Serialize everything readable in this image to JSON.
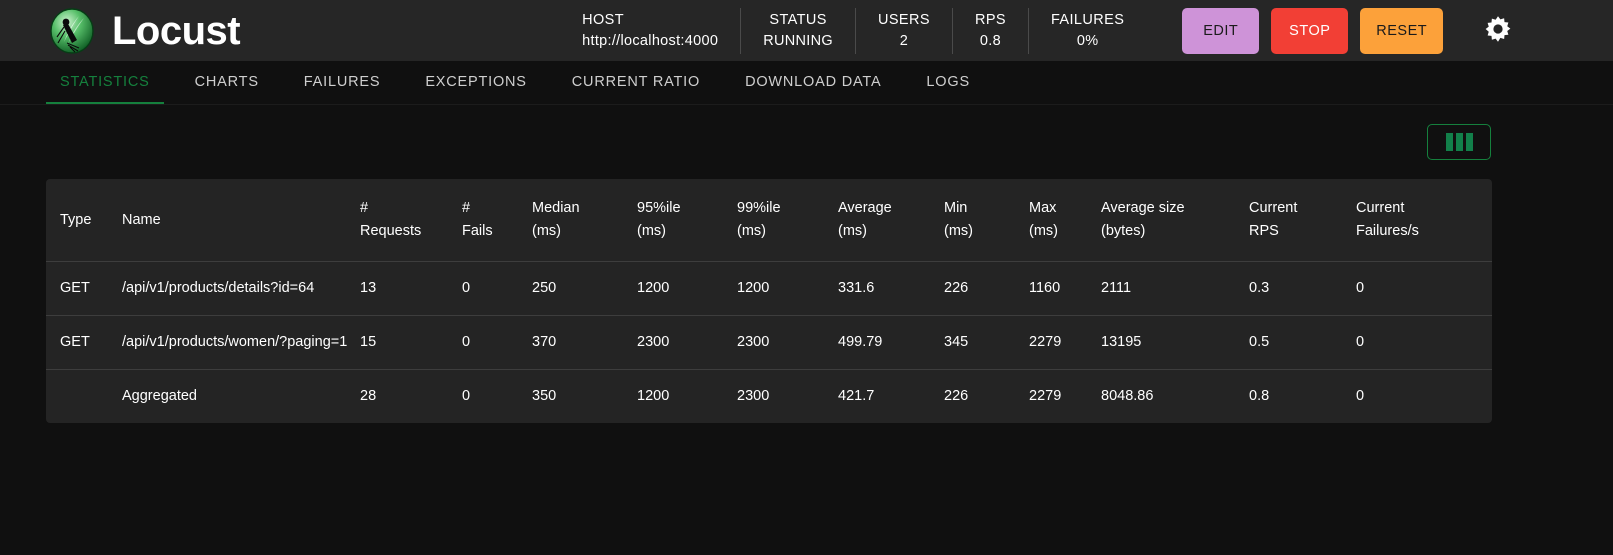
{
  "app": {
    "brand_name": "Locust",
    "logo_icon": "locust-logo-icon"
  },
  "header": {
    "stats": [
      {
        "label": "HOST",
        "value": "http://localhost:4000"
      },
      {
        "label": "STATUS",
        "value": "RUNNING"
      },
      {
        "label": "USERS",
        "value": "2"
      },
      {
        "label": "RPS",
        "value": "0.8"
      },
      {
        "label": "FAILURES",
        "value": "0%"
      }
    ],
    "buttons": {
      "edit": "EDIT",
      "stop": "STOP",
      "reset": "RESET"
    },
    "settings_icon": "gear-icon",
    "colors": {
      "edit_bg": "#ce93d8",
      "stop_bg": "#f23f35",
      "reset_bg": "#fca13a",
      "topbar_bg": "#262626"
    }
  },
  "tabs": {
    "active": "STATISTICS",
    "items": [
      {
        "label": "STATISTICS"
      },
      {
        "label": "CHARTS"
      },
      {
        "label": "FAILURES"
      },
      {
        "label": "EXCEPTIONS"
      },
      {
        "label": "CURRENT RATIO"
      },
      {
        "label": "DOWNLOAD DATA"
      },
      {
        "label": "LOGS"
      }
    ],
    "active_color": "#15803d"
  },
  "toolbar": {
    "column_select_icon": "column-select-icon",
    "accent_color": "#15803d"
  },
  "table": {
    "headers": [
      {
        "line1": "Type",
        "line2": ""
      },
      {
        "line1": "Name",
        "line2": ""
      },
      {
        "line1": "#",
        "line2": "Requests"
      },
      {
        "line1": "#",
        "line2": "Fails"
      },
      {
        "line1": "Median",
        "line2": "(ms)"
      },
      {
        "line1": "95%ile",
        "line2": "(ms)"
      },
      {
        "line1": "99%ile",
        "line2": "(ms)"
      },
      {
        "line1": "Average",
        "line2": "(ms)"
      },
      {
        "line1": "Min",
        "line2": "(ms)"
      },
      {
        "line1": "Max",
        "line2": "(ms)"
      },
      {
        "line1": "Average size",
        "line2": "(bytes)"
      },
      {
        "line1": "Current",
        "line2": "RPS"
      },
      {
        "line1": "Current",
        "line2": "Failures/s"
      }
    ],
    "rows": [
      {
        "type": "GET",
        "name": "/api/v1/products/details?id=64",
        "requests": "13",
        "fails": "0",
        "median": "250",
        "p95": "1200",
        "p99": "1200",
        "average": "331.6",
        "min": "226",
        "max": "1160",
        "avg_size": "2111",
        "current_rps": "0.3",
        "current_failures": "0"
      },
      {
        "type": "GET",
        "name": "/api/v1/products/women/?paging=1",
        "requests": "15",
        "fails": "0",
        "median": "370",
        "p95": "2300",
        "p99": "2300",
        "average": "499.79",
        "min": "345",
        "max": "2279",
        "avg_size": "13195",
        "current_rps": "0.5",
        "current_failures": "0"
      },
      {
        "type": "",
        "name": "Aggregated",
        "requests": "28",
        "fails": "0",
        "median": "350",
        "p95": "1200",
        "p99": "2300",
        "average": "421.7",
        "min": "226",
        "max": "2279",
        "avg_size": "8048.86",
        "current_rps": "0.8",
        "current_failures": "0"
      }
    ]
  }
}
